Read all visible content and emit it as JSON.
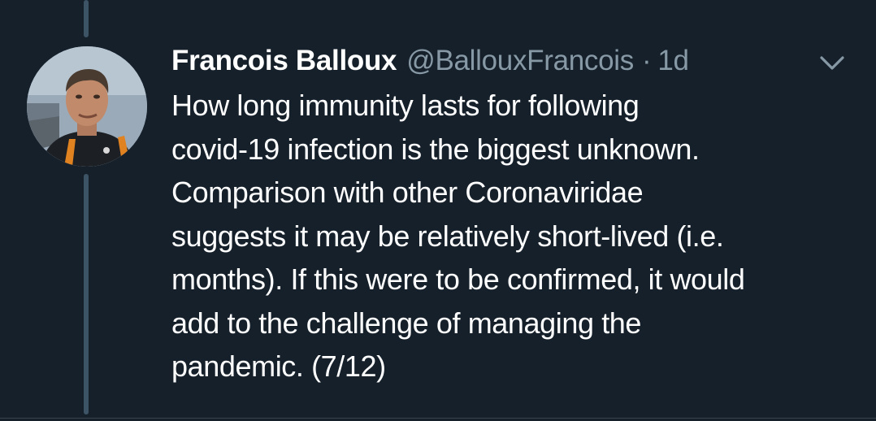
{
  "tweet": {
    "author": {
      "display_name": "Francois Balloux",
      "handle": "@BallouxFrancois"
    },
    "separator": "·",
    "time_ago": "1d",
    "text_lines": [
      "How long immunity lasts for following",
      "covid-19 infection is the biggest unknown.",
      "Comparison with other Coronaviridae",
      "suggests it may be relatively short-lived (i.e.",
      "months). If this were to be confirmed, it would",
      "add to the challenge of managing the",
      "pandemic. (7/12)"
    ],
    "menu_icon": "chevron-down-icon"
  },
  "colors": {
    "background": "#15202b",
    "primary_text": "#ffffff",
    "secondary_text": "#8899a6",
    "thread_line": "#3d5466",
    "divider": "#38444d"
  }
}
